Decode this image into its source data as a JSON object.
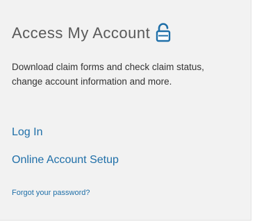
{
  "panel": {
    "title": "Access My Account",
    "lock_icon": "unlocked-padlock-icon",
    "accent_color": "#1f6fa8",
    "description": "Download claim forms and check claim status, change account information and more.",
    "links": {
      "login": "Log In",
      "setup": "Online Account Setup",
      "forgot": "Forgot your password?"
    }
  }
}
